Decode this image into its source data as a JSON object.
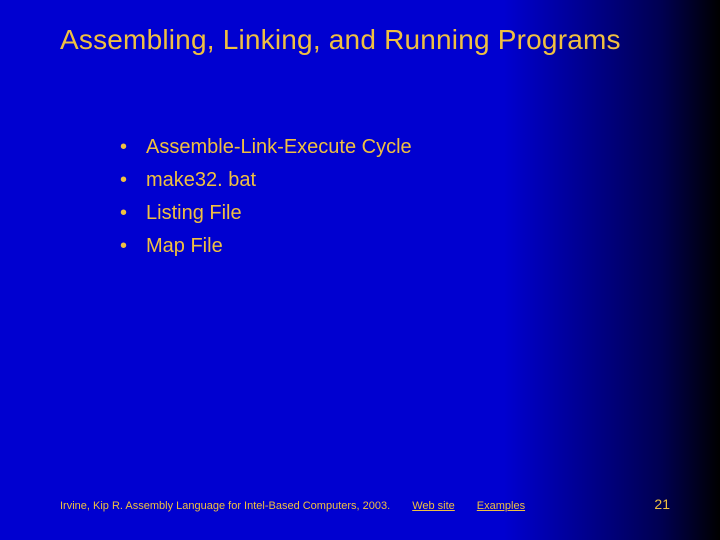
{
  "title": "Assembling, Linking, and Running Programs",
  "bullets": [
    "Assemble-Link-Execute Cycle",
    "make32. bat",
    "Listing File",
    "Map File"
  ],
  "footer": {
    "credit": "Irvine, Kip R. Assembly Language for Intel-Based Computers, 2003.",
    "links": [
      "Web site",
      "Examples"
    ],
    "page": "21"
  }
}
